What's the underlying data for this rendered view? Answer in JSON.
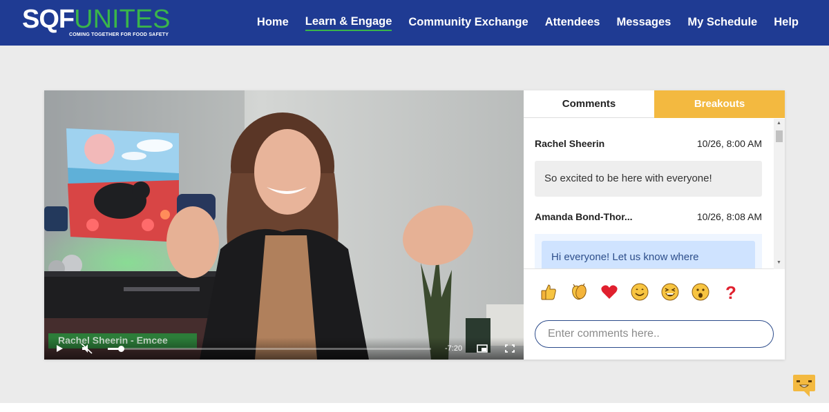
{
  "header": {
    "logo_left": "SQF",
    "logo_right": "UNITES",
    "logo_tagline": "COMING TOGETHER FOR FOOD SAFETY",
    "nav": [
      {
        "label": "Home",
        "active": false
      },
      {
        "label": "Learn & Engage",
        "active": true
      },
      {
        "label": "Community Exchange",
        "active": false
      },
      {
        "label": "Attendees",
        "active": false
      },
      {
        "label": "Messages",
        "active": false
      },
      {
        "label": "My Schedule",
        "active": false
      },
      {
        "label": "Help",
        "active": false
      }
    ]
  },
  "video": {
    "lower_third": "Rachel Sheerin - Emcee",
    "time_remaining": "-7:20",
    "muted": true,
    "progress": 0.04
  },
  "panel": {
    "tabs": {
      "comments": "Comments",
      "breakouts": "Breakouts"
    },
    "messages": [
      {
        "name": "Rachel Sheerin",
        "time": "10/26, 8:00 AM",
        "text": "So excited to be here with everyone!"
      },
      {
        "name": "Amanda Bond-Thor...",
        "time": "10/26, 8:08 AM",
        "text": "Hi everyone! Let us know where"
      }
    ],
    "reactions": [
      "thumbs-up",
      "clapping-hands",
      "heart",
      "smile",
      "laughing",
      "surprised",
      "question"
    ],
    "input_placeholder": "Enter comments here.."
  },
  "colors": {
    "header_bg": "#1f3b93",
    "accent_green": "#3ab54a",
    "breakouts_tab": "#f3b940",
    "page_bg": "#ebebeb"
  }
}
